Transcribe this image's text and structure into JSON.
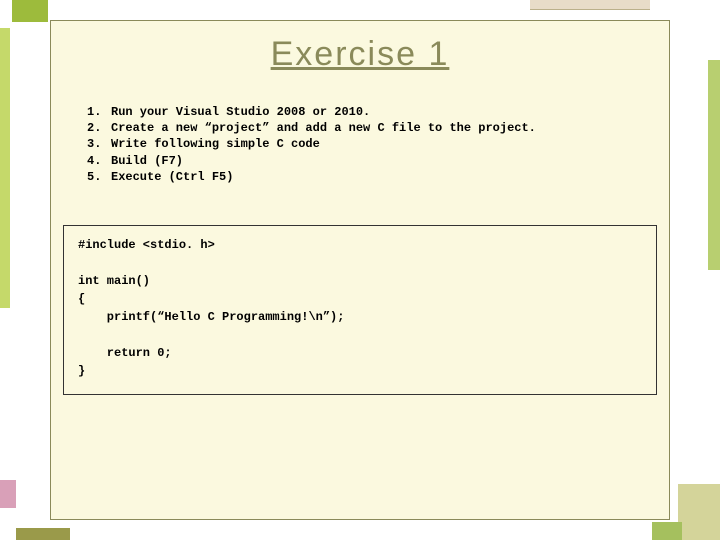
{
  "title": "Exercise 1",
  "steps": [
    {
      "num": "1.",
      "text": "Run your Visual Studio 2008 or 2010."
    },
    {
      "num": "2.",
      "text": "Create a new “project” and add a new C file to the project."
    },
    {
      "num": "3.",
      "text": "Write following simple C code"
    },
    {
      "num": "4.",
      "text": "Build (F7)"
    },
    {
      "num": "5.",
      "text": "Execute (Ctrl F5)"
    }
  ],
  "code": "#include <stdio. h>\n\nint main()\n{\n    printf(“Hello C Programming!\\n”);\n\n    return 0;\n}"
}
